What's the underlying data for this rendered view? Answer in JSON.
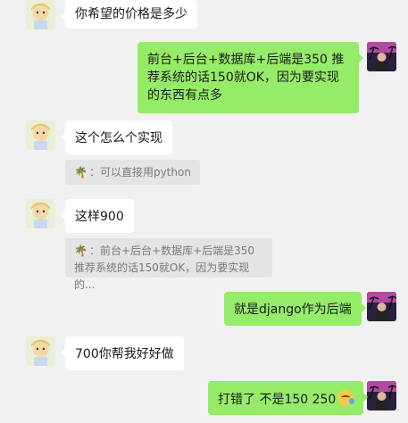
{
  "messages": [
    {
      "side": "in",
      "text": "你希望的价格是多少"
    },
    {
      "side": "out",
      "text": "前台+后台+数据库+后端是350 推荐系统的话150就OK，因为要实现的东西有点多"
    },
    {
      "side": "in",
      "text": "这个怎么个实现"
    },
    {
      "side": "quote",
      "icon": "palm-tree-icon",
      "text": "：可以直接用python"
    },
    {
      "side": "in",
      "text": "这样900"
    },
    {
      "side": "quote",
      "icon": "palm-tree-icon",
      "text": "：前台+后台+数据库+后端是350 推荐系统的话150就OK，因为要实现的..."
    },
    {
      "side": "out",
      "text": "就是django作为后端"
    },
    {
      "side": "in",
      "text": "700你帮我好好做"
    },
    {
      "side": "out",
      "text": "打错了 不是150 250",
      "emoji": "crying-laughing-emoji"
    }
  ],
  "colors": {
    "background": "#f1f1f1",
    "incoming_bubble": "#ffffff",
    "outgoing_bubble": "#95ec69",
    "quote_bg": "#e4e4e4"
  }
}
